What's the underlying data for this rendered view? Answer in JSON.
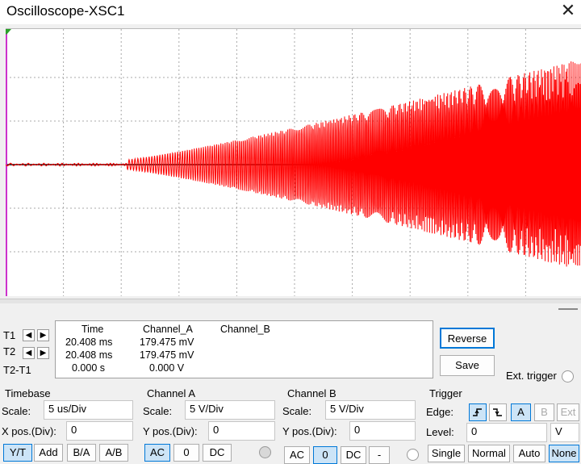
{
  "window": {
    "title": "Oscilloscope-XSC1",
    "close_glyph": "✕"
  },
  "colors": {
    "trace_a": "#ff0000",
    "grid": "#a8a8a8",
    "cursor": "#cc33cc",
    "selected": "#cce4f7"
  },
  "readout": {
    "headers": {
      "time": "Time",
      "channel_a": "Channel_A",
      "channel_b": "Channel_B"
    },
    "rows": [
      {
        "label": "T1",
        "time": "20.408 ms",
        "channel_a": "179.475 mV",
        "channel_b": ""
      },
      {
        "label": "T2",
        "time": "20.408 ms",
        "channel_a": "179.475 mV",
        "channel_b": ""
      },
      {
        "label": "T2-T1",
        "time": "0.000 s",
        "channel_a": "0.000 V",
        "channel_b": ""
      }
    ]
  },
  "actions": {
    "reverse": "Reverse",
    "save": "Save",
    "ext_trigger": "Ext. trigger"
  },
  "timebase": {
    "title": "Timebase",
    "scale_label": "Scale:",
    "scale": "5 us/Div",
    "xpos_label": "X pos.(Div):",
    "xpos": "0",
    "modes": [
      "Y/T",
      "Add",
      "B/A",
      "A/B"
    ],
    "mode_selected": "Y/T"
  },
  "channel_a": {
    "title": "Channel A",
    "scale_label": "Scale:",
    "scale": "5  V/Div",
    "ypos_label": "Y pos.(Div):",
    "ypos": "0",
    "couplings": [
      "AC",
      "0",
      "DC"
    ],
    "coupling_selected": "AC"
  },
  "channel_b": {
    "title": "Channel B",
    "scale_label": "Scale:",
    "scale": "5  V/Div",
    "ypos_label": "Y pos.(Div):",
    "ypos": "0",
    "couplings": [
      "AC",
      "0",
      "DC",
      "-"
    ],
    "coupling_selected": "0"
  },
  "trigger": {
    "title": "Trigger",
    "edge_label": "Edge:",
    "edge_sources": [
      "A",
      "B",
      "Ext"
    ],
    "edge_selected": "A",
    "level_label": "Level:",
    "level": "0",
    "level_unit": "V",
    "modes": [
      "Single",
      "Normal",
      "Auto",
      "None"
    ],
    "mode_selected": "None"
  },
  "display": {
    "horizontal_divisions": 10,
    "vertical_divisions": 6
  }
}
